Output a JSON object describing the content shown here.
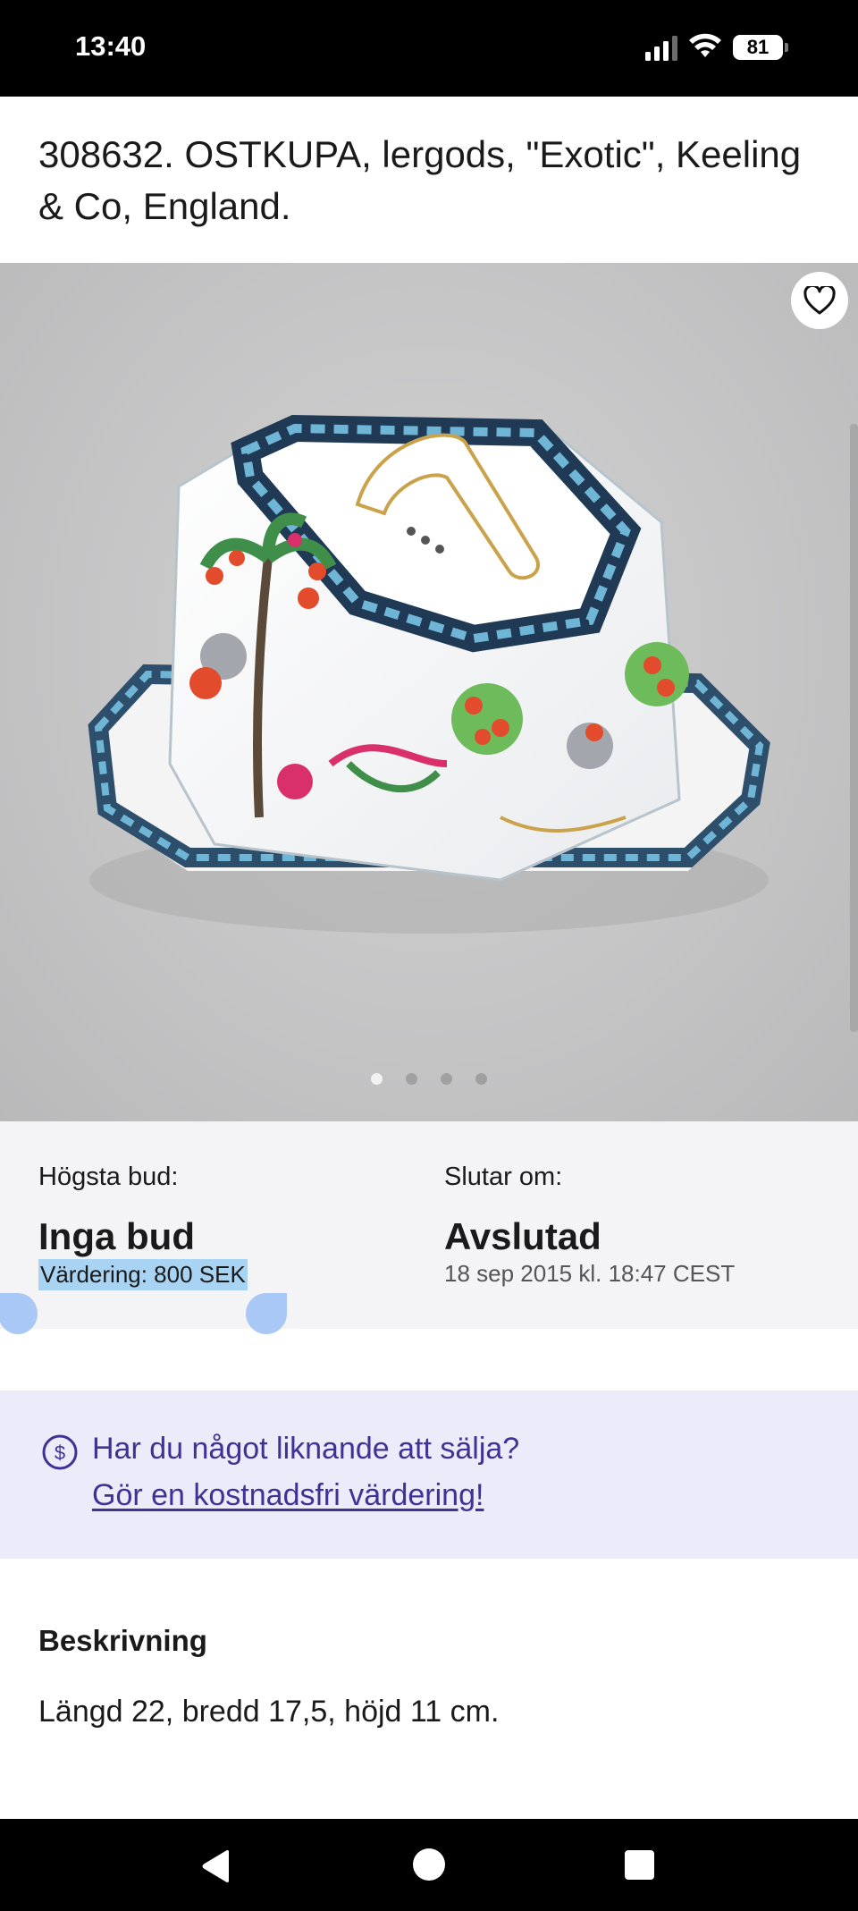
{
  "status_bar": {
    "time": "13:40",
    "battery": "81",
    "icons": [
      "signal-icon",
      "wifi-icon",
      "battery-icon"
    ]
  },
  "lot": {
    "title": "308632. OSTKUPA, lergods, \"Exotic\", Keeling & Co, England."
  },
  "gallery": {
    "image_alt": "cheese dome",
    "image_count": 4,
    "active_index": 0,
    "favorite_icon": "heart-icon"
  },
  "bid": {
    "highest_bid_label": "Högsta bud:",
    "highest_bid_value": "Inga bud",
    "valuation": "Värdering: 800 SEK",
    "ends_label": "Slutar om:",
    "ends_value": "Avslutad",
    "end_date": "18 sep 2015 kl. 18:47 CEST"
  },
  "promo": {
    "icon": "dollar-circle-icon",
    "text": "Har du något liknande att sälja?",
    "link": "Gör en kostnadsfri värdering!",
    "color": "#3e3395"
  },
  "description": {
    "heading": "Beskrivning",
    "text": "Längd 22, bredd 17,5, höjd 11 cm."
  },
  "nav": {
    "icons": [
      "back-icon",
      "home-icon",
      "recents-icon"
    ]
  }
}
